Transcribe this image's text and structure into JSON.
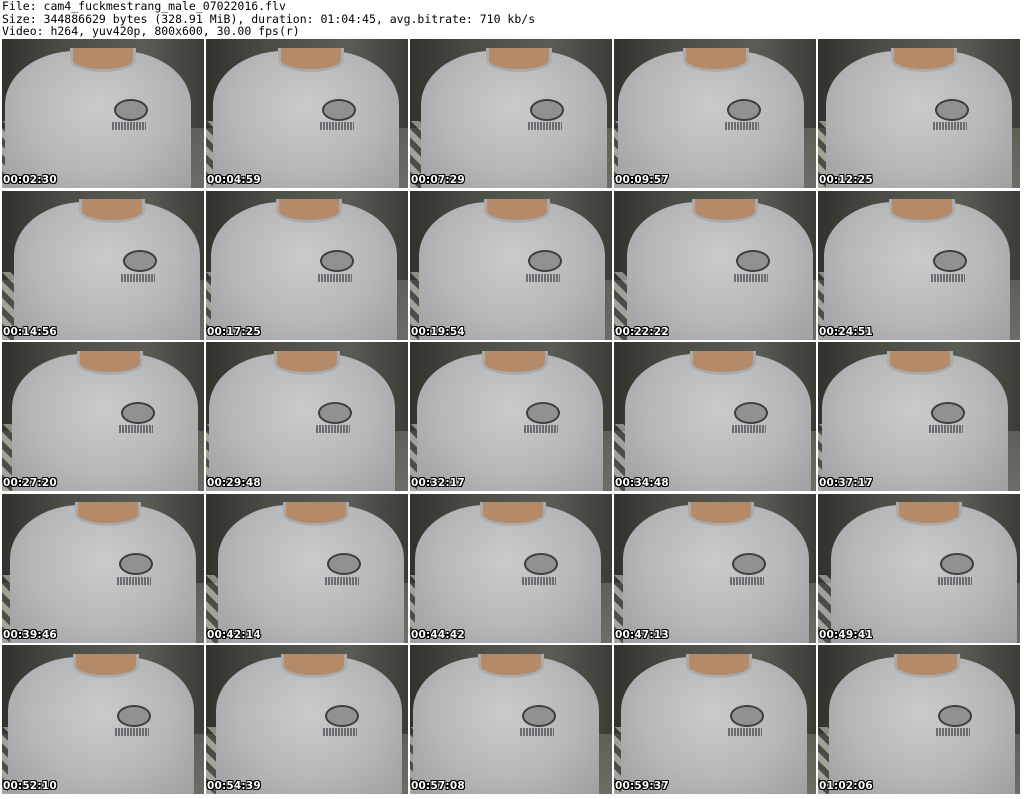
{
  "header": {
    "line1": "File: cam4_fuckmestrang_male_07022016.flv",
    "line2": "Size: 344886629 bytes (328.91 MiB), duration: 01:04:45, avg.bitrate: 710 kb/s",
    "line3": "Video: h264, yuv420p, 800x600, 30.00 fps(r)"
  },
  "thumbnails": [
    {
      "time": "00:02:30"
    },
    {
      "time": "00:04:59"
    },
    {
      "time": "00:07:29"
    },
    {
      "time": "00:09:57"
    },
    {
      "time": "00:12:25"
    },
    {
      "time": "00:14:56"
    },
    {
      "time": "00:17:25"
    },
    {
      "time": "00:19:54"
    },
    {
      "time": "00:22:22"
    },
    {
      "time": "00:24:51"
    },
    {
      "time": "00:27:20"
    },
    {
      "time": "00:29:48"
    },
    {
      "time": "00:32:17"
    },
    {
      "time": "00:34:48"
    },
    {
      "time": "00:37:17"
    },
    {
      "time": "00:39:46"
    },
    {
      "time": "00:42:14"
    },
    {
      "time": "00:44:42"
    },
    {
      "time": "00:47:13"
    },
    {
      "time": "00:49:41"
    },
    {
      "time": "00:52:10"
    },
    {
      "time": "00:54:39"
    },
    {
      "time": "00:57:08"
    },
    {
      "time": "00:59:37"
    },
    {
      "time": "01:02:06"
    }
  ]
}
